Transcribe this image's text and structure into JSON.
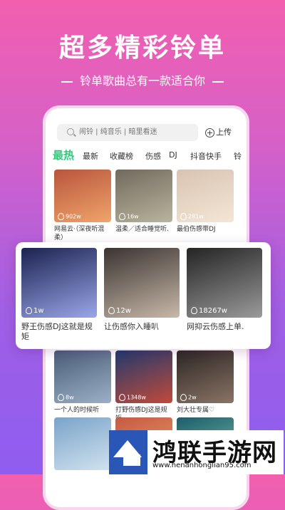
{
  "hero": {
    "headline": "超多精彩铃单",
    "subline": "铃单歌曲总有一款适合你"
  },
  "app": {
    "search_placeholder": "闹铃 | 纯音乐 | 暗里看迷",
    "upload_label": "上传",
    "tabs": [
      "最热",
      "最新",
      "收藏榜",
      "伤感",
      "DJ",
      "抖音快手",
      "铃"
    ],
    "active_tab": "最热",
    "grid": [
      {
        "count": "902w",
        "title": "网易云·（深夜听混柔）",
        "colors": [
          "#b8553d",
          "#f0a46a"
        ]
      },
      {
        "count": "16w",
        "title": "温柔／适合睡觉听.",
        "colors": [
          "#6f6a5c",
          "#b9b49e"
        ]
      },
      {
        "count": "281w",
        "title": "最伯伤感带DJ",
        "colors": [
          "#d9c3b2",
          "#f3e6d6"
        ]
      },
      {
        "count": "8w",
        "title": "一个人的时候听",
        "colors": [
          "#4a5c78",
          "#9bb0c6"
        ]
      },
      {
        "count": "1348w",
        "title": "打野伤感DJ这是规矩",
        "colors": [
          "#213a6e",
          "#c04a3a"
        ]
      },
      {
        "count": "2w",
        "title": "刘大壮专属♡",
        "colors": [
          "#2c2624",
          "#8a7466"
        ]
      },
      {
        "count": "",
        "title": "",
        "colors": [
          "#7aa3c9",
          "#d0e2ef"
        ]
      },
      {
        "count": "",
        "title": "",
        "colors": [
          "#c45a42",
          "#f0a06c"
        ]
      },
      {
        "count": "",
        "title": "",
        "colors": [
          "#1e5c6b",
          "#78c4a8"
        ]
      }
    ],
    "featured": [
      {
        "count": "1w",
        "title": "野王伤感DJ这就是规矩",
        "colors": [
          "#1b2250",
          "#9aa6e8"
        ]
      },
      {
        "count": "12w",
        "title": "让伤感你入睡叭",
        "colors": [
          "#3a3432",
          "#c8b8a8"
        ]
      },
      {
        "count": "18267w",
        "title": "网抑云伤感上单.",
        "colors": [
          "#242424",
          "#9a9a9a"
        ]
      }
    ]
  },
  "watermark": {
    "name": "鸿联手游网",
    "url": "www.henanhonglian95.com"
  }
}
